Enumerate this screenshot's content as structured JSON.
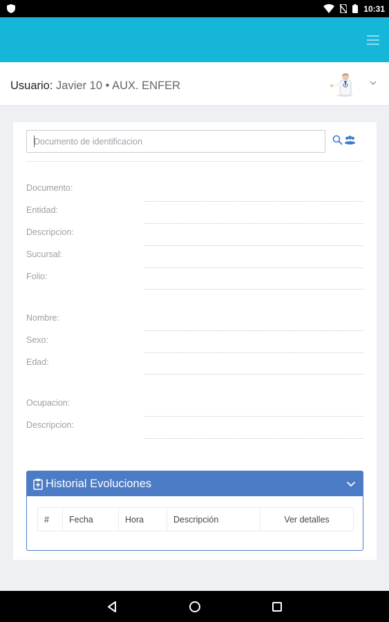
{
  "status_bar": {
    "time": "10:31",
    "icons": [
      "shield-icon",
      "wifi-icon",
      "no-sim-icon",
      "battery-icon"
    ],
    "color": "#000000"
  },
  "app_bar": {
    "color": "#16b6d8",
    "menu_icon": "hamburger-icon"
  },
  "user": {
    "label": "Usuario:",
    "name": "Javier 10",
    "separator": "•",
    "role": "AUX. ENFER",
    "avatar": "doctor-avatar"
  },
  "search": {
    "placeholder": "Documento de identificacion",
    "value": "",
    "search_icon": "search-icon",
    "patients_icon": "users-icon"
  },
  "fields": [
    {
      "label": "Documento:",
      "value": ""
    },
    {
      "label": "Entidad:",
      "value": ""
    },
    {
      "label": "Descripcion:",
      "value": ""
    },
    {
      "label": "Sucursal:",
      "value": ""
    },
    {
      "label": "Folio:",
      "value": ""
    },
    {
      "label": "Nombre:",
      "value": ""
    },
    {
      "label": "Sexo:",
      "value": ""
    },
    {
      "label": "Edad:",
      "value": ""
    },
    {
      "label": "Ocupacion:",
      "value": ""
    },
    {
      "label": "Descripcion:",
      "value": ""
    }
  ],
  "history": {
    "title": "Historial Evoluciones",
    "color": "#4c7cc5",
    "columns": [
      "#",
      "Fecha",
      "Hora",
      "Descripción",
      "Ver detalles"
    ],
    "rows": []
  },
  "nav_bar": {
    "buttons": [
      "back-button",
      "home-button",
      "recents-button"
    ]
  }
}
